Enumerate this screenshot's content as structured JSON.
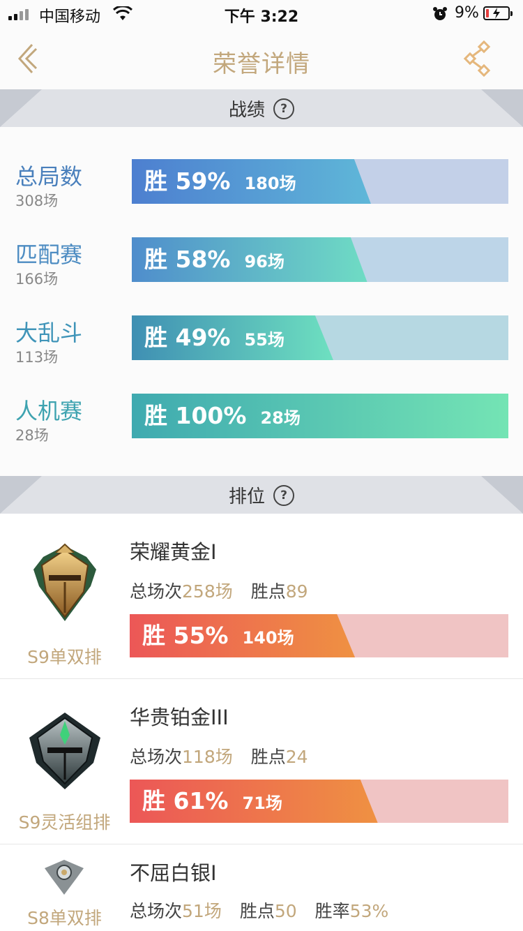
{
  "status_bar": {
    "carrier": "中国移动",
    "time": "下午 3:22",
    "battery_percent": "9%",
    "icons": [
      "signal-icon",
      "wifi-icon",
      "alarm-icon",
      "battery-icon"
    ]
  },
  "nav": {
    "title": "荣誉详情",
    "back_icon": "back-chevron-icon",
    "share_icon": "share-icon",
    "accent_color": "#c2a77c"
  },
  "sections": {
    "record_title": "战绩",
    "rank_title": "排位"
  },
  "records": [
    {
      "name": "总局数",
      "count": "308场",
      "win_label": "胜 59%",
      "games": "180场",
      "win_rate": 59
    },
    {
      "name": "匹配赛",
      "count": "166场",
      "win_label": "胜 58%",
      "games": "96场",
      "win_rate": 58
    },
    {
      "name": "大乱斗",
      "count": "113场",
      "win_label": "胜 49%",
      "games": "55场",
      "win_rate": 49
    },
    {
      "name": "人机赛",
      "count": "28场",
      "win_label": "胜 100%",
      "games": "28场",
      "win_rate": 100
    }
  ],
  "ranks": [
    {
      "badge_icon": "gold-rank-helmet-icon",
      "queue": "S9单双排",
      "tier": "荣耀黄金I",
      "total_label": "总场次",
      "total": "258场",
      "points_label": "胜点",
      "points": "89",
      "win_label": "胜 55%",
      "games": "140场",
      "win_rate": 55
    },
    {
      "badge_icon": "platinum-rank-helmet-icon",
      "queue": "S9灵活组排",
      "tier": "华贵铂金III",
      "total_label": "总场次",
      "total": "118场",
      "points_label": "胜点",
      "points": "24",
      "win_label": "胜 61%",
      "games": "71场",
      "win_rate": 61
    },
    {
      "badge_icon": "silver-rank-badge-icon",
      "queue": "S8单双排",
      "tier": "不屈白银I",
      "total_label": "总场次",
      "total": "51场",
      "points_label": "胜点",
      "points": "50",
      "rate_label": "胜率",
      "rate": "53%"
    }
  ]
}
